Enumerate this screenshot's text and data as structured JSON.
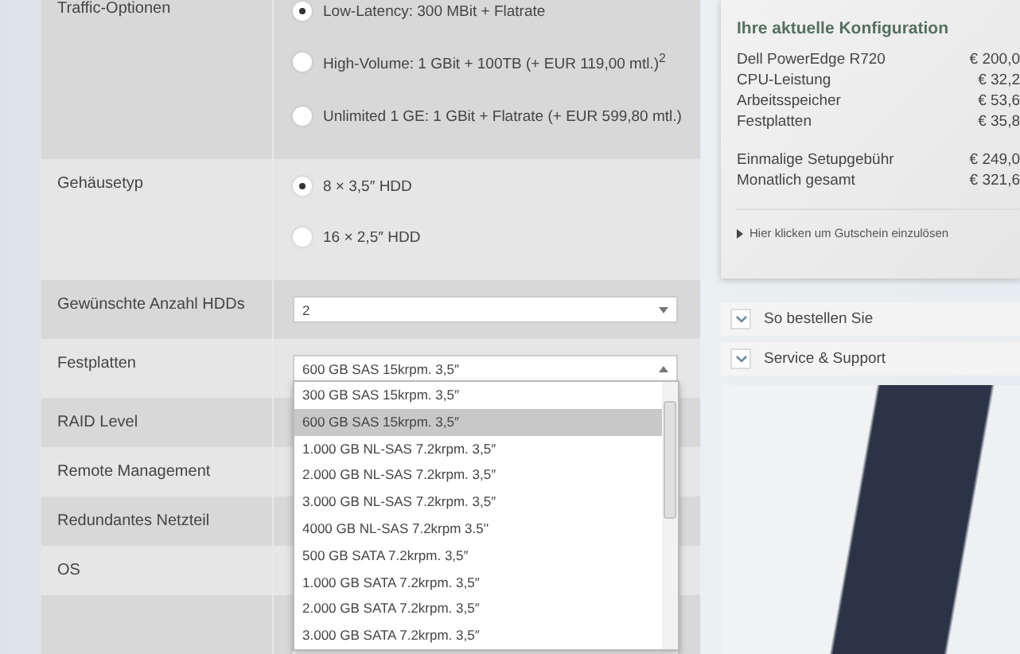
{
  "form": {
    "rows": [
      {
        "label": "Traffic-Optionen",
        "kind": "radio",
        "options": [
          {
            "label": "Low-Latency: 300 MBit + Flatrate",
            "selected": true
          },
          {
            "label": "High-Volume: 1 GBit + 100TB (+ EUR 119,00 mtl.)$^{2}$",
            "selected": false
          },
          {
            "label": "Unlimited 1 GE: 1 GBit + Flatrate (+ EUR 599,80 mtl.)",
            "selected": false
          }
        ]
      },
      {
        "label": "Gehäusetyp",
        "kind": "radio",
        "options": [
          {
            "label": "8 × 3,5″ HDD",
            "selected": true
          },
          {
            "label": "16 × 2,5″ HDD",
            "selected": false
          }
        ]
      },
      {
        "label": "Gewünschte Anzahl HDDs",
        "kind": "select",
        "value": "2"
      },
      {
        "label": "Festplatten",
        "kind": "dropdown",
        "value": "600 GB SAS 15krpm. 3,5″",
        "options": [
          {
            "label": "300 GB SAS 15krpm. 3,5″",
            "selected": false
          },
          {
            "label": "600 GB SAS 15krpm. 3,5″",
            "selected": true
          },
          {
            "label": "1.000 GB NL-SAS 7.2krpm. 3,5″",
            "selected": false
          },
          {
            "label": "2.000 GB NL-SAS 7.2krpm. 3,5″",
            "selected": false
          },
          {
            "label": "3.000 GB NL-SAS 7.2krpm. 3,5″",
            "selected": false
          },
          {
            "label": "4000 GB NL-SAS 7.2krpm 3.5''",
            "selected": false
          },
          {
            "label": "500 GB SATA 7.2krpm. 3,5″",
            "selected": false
          },
          {
            "label": "1.000 GB SATA 7.2krpm. 3,5″",
            "selected": false
          },
          {
            "label": "2.000 GB SATA 7.2krpm. 3,5″",
            "selected": false
          },
          {
            "label": "3.000 GB SATA 7.2krpm. 3,5″",
            "selected": false
          }
        ]
      },
      {
        "label": "RAID Level",
        "kind": "empty"
      },
      {
        "label": "Remote Management",
        "kind": "empty"
      },
      {
        "label": "Redundantes Netzteil",
        "kind": "empty"
      },
      {
        "label": "OS",
        "kind": "empty"
      },
      {
        "kind": "field"
      }
    ]
  },
  "summary": {
    "title": "Ihre aktuelle Konfiguration",
    "items": [
      {
        "label": "Dell PowerEdge R720",
        "price": "€ 200,0"
      },
      {
        "label": "CPU-Leistung",
        "price": "€ 32,2"
      },
      {
        "label": "Arbeitsspeicher",
        "price": "€ 53,6"
      },
      {
        "label": "Festplatten",
        "price": "€ 35,8"
      }
    ],
    "totals": [
      {
        "label": "Einmalige Setupgebühr",
        "price": "€ 249,0"
      },
      {
        "label": "Monatlich gesamt",
        "price": "€ 321,6"
      }
    ],
    "voucher_link": "Hier klicken um Gutschein einzulösen"
  },
  "accordion": [
    {
      "label": "So bestellen Sie",
      "expanded": false
    },
    {
      "label": "Service & Support",
      "expanded": false
    }
  ]
}
